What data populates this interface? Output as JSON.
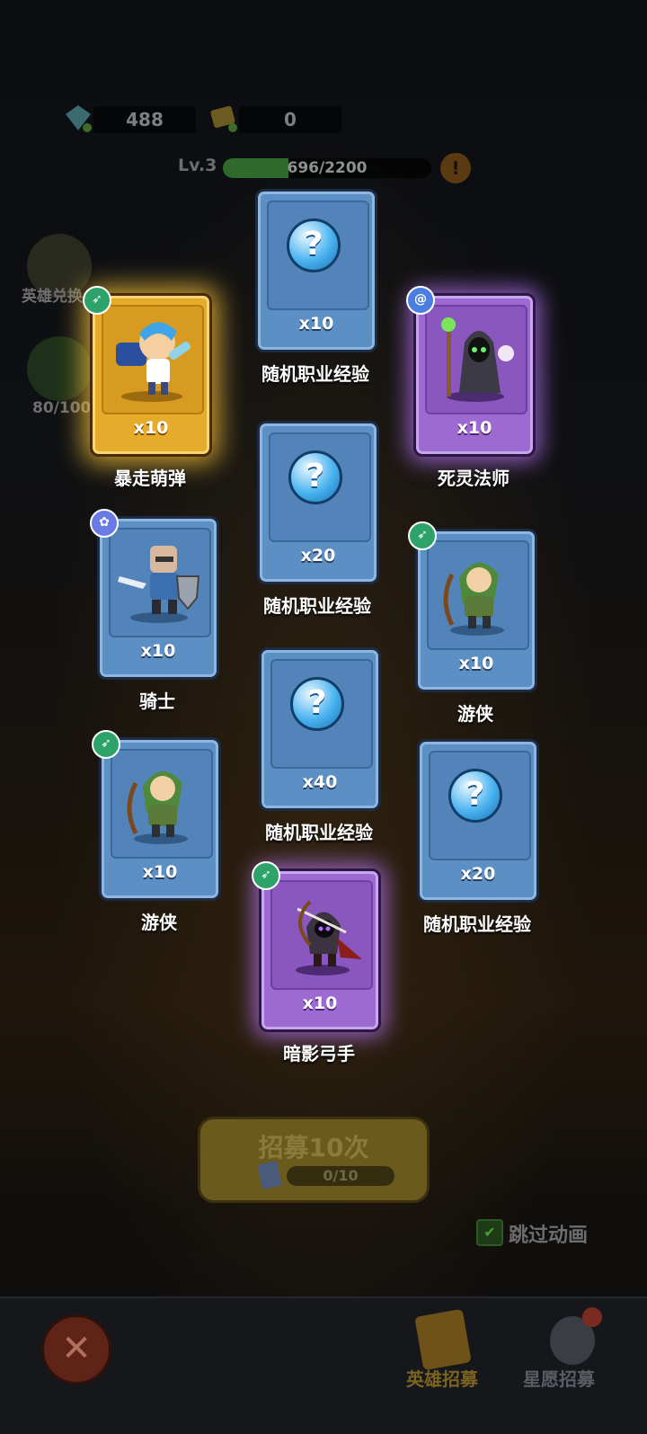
{
  "header": {
    "gems": "488",
    "tickets": "0",
    "level": "Lv.3",
    "exp_text": "696/2200",
    "exp_progress": 0.316
  },
  "side": {
    "hero_exchange": "英雄兑换",
    "star_count": "80/100"
  },
  "cards": [
    {
      "name": "随机职业经验",
      "count": "x10",
      "rarity": "blue",
      "icon": "question-orb-icon"
    },
    {
      "name": "暴走萌弹",
      "count": "x10",
      "rarity": "gold",
      "icon": "hero-gunner-icon",
      "class_icon": "bow-class-icon"
    },
    {
      "name": "死灵法师",
      "count": "x10",
      "rarity": "purple",
      "icon": "hero-necromancer-icon",
      "class_icon": "swirl-class-icon"
    },
    {
      "name": "随机职业经验",
      "count": "x20",
      "rarity": "blue",
      "icon": "question-orb-icon"
    },
    {
      "name": "骑士",
      "count": "x10",
      "rarity": "blue",
      "icon": "hero-knight-icon",
      "class_icon": "paw-class-icon"
    },
    {
      "name": "游侠",
      "count": "x10",
      "rarity": "blue",
      "icon": "hero-ranger-icon",
      "class_icon": "bow-class-icon"
    },
    {
      "name": "随机职业经验",
      "count": "x40",
      "rarity": "blue",
      "icon": "question-orb-icon"
    },
    {
      "name": "游侠",
      "count": "x10",
      "rarity": "blue",
      "icon": "hero-ranger-icon",
      "class_icon": "bow-class-icon"
    },
    {
      "name": "随机职业经验",
      "count": "x20",
      "rarity": "blue",
      "icon": "question-orb-icon"
    },
    {
      "name": "暗影弓手",
      "count": "x10",
      "rarity": "purple",
      "icon": "hero-shadow-archer-icon",
      "class_icon": "bow-class-icon"
    }
  ],
  "recruit": {
    "label": "招募10次",
    "progress": "0/10"
  },
  "skip": {
    "label": "跳过动画",
    "checked": true
  },
  "nav": {
    "hero_recruit": "英雄招募",
    "wish_recruit": "星愿招募"
  },
  "colors": {
    "blue_card": "#5c8fc4",
    "gold_card": "#e7ab2c",
    "purple_card": "#9d6ad2"
  }
}
